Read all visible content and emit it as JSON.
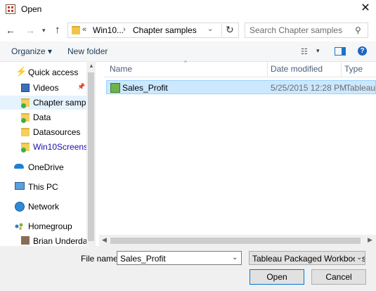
{
  "window": {
    "title": "Open",
    "close_glyph": "✕"
  },
  "nav": {
    "back_glyph": "←",
    "forward_glyph": "→",
    "recent_glyph": "▾",
    "up_glyph": "↑",
    "address": {
      "overflow": "«",
      "segments": [
        "Win10...",
        "Chapter samples"
      ],
      "separator": "›",
      "dropdown_glyph": "⌄",
      "refresh_glyph": "↻"
    },
    "search": {
      "placeholder": "Search Chapter samples",
      "icon_glyph": "⚲"
    }
  },
  "toolbar": {
    "organize_label": "Organize ▾",
    "new_folder_label": "New folder",
    "view_options_glyph": "☷",
    "view_dropdown_glyph": "▾",
    "help_glyph": "?"
  },
  "sidebar": {
    "items": [
      {
        "label": "Quick access",
        "icon": "star-icon"
      },
      {
        "label": "Videos",
        "icon": "video-folder-icon",
        "pinned": true
      },
      {
        "label": "Chapter samples",
        "icon": "folder-icon",
        "selected": true
      },
      {
        "label": "Data",
        "icon": "folder-icon"
      },
      {
        "label": "Datasources",
        "icon": "folder-icon"
      },
      {
        "label": "Win10Screens",
        "icon": "folder-icon",
        "color": "#1a0dab"
      },
      {
        "label": "OneDrive",
        "icon": "cloud-icon"
      },
      {
        "label": "This PC",
        "icon": "computer-icon"
      },
      {
        "label": "Network",
        "icon": "network-icon"
      },
      {
        "label": "Homegroup",
        "icon": "homegroup-icon"
      },
      {
        "label": "Brian Underdahl",
        "icon": "user-icon"
      }
    ],
    "pin_glyph": "📌"
  },
  "filelist": {
    "columns": [
      "Name",
      "Date modified",
      "Type"
    ],
    "sort_glyph": "^",
    "rows": [
      {
        "name": "Sales_Profit",
        "date": "5/25/2015 12:28 PM",
        "type": "Tableau P"
      }
    ]
  },
  "scroll": {
    "up": "▲",
    "left": "◀",
    "right": "▶"
  },
  "bottom": {
    "filename_label": "File name:",
    "filename_value": "Sales_Profit",
    "filter_value": "Tableau Packaged Workbooks (",
    "drop_glyph": "⌄",
    "open_label": "Open",
    "cancel_label": "Cancel"
  },
  "colors": {
    "accent": "#0078d7",
    "selection": "#cce8ff",
    "link": "#1e395b"
  }
}
